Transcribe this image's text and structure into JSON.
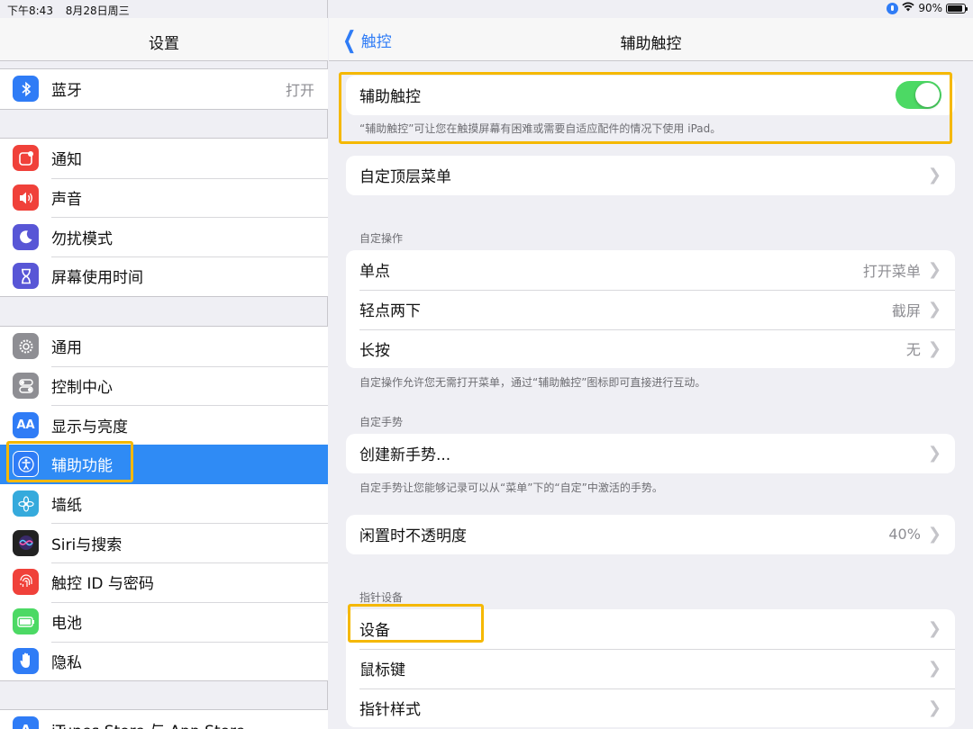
{
  "status_bar": {
    "time": "下午8:43",
    "date": "8月28日周三",
    "battery_pct": "90%",
    "battery_level": 0.9
  },
  "left": {
    "title": "设置",
    "group1": [
      {
        "icon": "bluetooth-icon",
        "label": "蓝牙",
        "value": "打开",
        "color": "#2f7cf6"
      }
    ],
    "group2": [
      {
        "icon": "notifications-icon",
        "label": "通知",
        "color": "#f0413a"
      },
      {
        "icon": "sound-icon",
        "label": "声音",
        "color": "#f0413a"
      },
      {
        "icon": "moon-icon",
        "label": "勿扰模式",
        "color": "#5856d6"
      },
      {
        "icon": "hourglass-icon",
        "label": "屏幕使用时间",
        "color": "#5856d6"
      }
    ],
    "group3": [
      {
        "icon": "gear-icon",
        "label": "通用",
        "color": "#8e8e93"
      },
      {
        "icon": "control-center-icon",
        "label": "控制中心",
        "color": "#8e8e93"
      },
      {
        "icon": "display-icon",
        "label": "显示与亮度",
        "color": "#2f7cf6"
      },
      {
        "icon": "accessibility-icon",
        "label": "辅助功能",
        "color": "#2f7cf6",
        "selected": true
      },
      {
        "icon": "wallpaper-icon",
        "label": "墙纸",
        "color": "#35aadc"
      },
      {
        "icon": "siri-icon",
        "label": "Siri与搜索",
        "color": "#222"
      },
      {
        "icon": "fingerprint-icon",
        "label": "触控 ID 与密码",
        "color": "#f0413a"
      },
      {
        "icon": "battery-icon",
        "label": "电池",
        "color": "#4cd964"
      },
      {
        "icon": "hand-icon",
        "label": "隐私",
        "color": "#2f7cf6"
      }
    ],
    "group4": [
      {
        "icon": "app-store-icon",
        "label": "iTunes Store 与 App Store",
        "color": "#2f7cf6"
      }
    ]
  },
  "right": {
    "back_label": "触控",
    "title": "辅助触控",
    "toggle": {
      "label": "辅助触控",
      "on": true,
      "note": "“辅助触控”可让您在触摸屏幕有困难或需要自适应配件的情况下使用 iPad。"
    },
    "top_menu": {
      "label": "自定顶层菜单"
    },
    "custom_actions": {
      "header": "自定操作",
      "items": [
        {
          "label": "单点",
          "value": "打开菜单"
        },
        {
          "label": "轻点两下",
          "value": "截屏"
        },
        {
          "label": "长按",
          "value": "无"
        }
      ],
      "note": "自定操作允许您无需打开菜单，通过“辅助触控”图标即可直接进行互动。"
    },
    "custom_gestures": {
      "header": "自定手势",
      "items": [
        {
          "label": "创建新手势..."
        }
      ],
      "note": "自定手势让您能够记录可以从“菜单”下的“自定”中激活的手势。"
    },
    "idle_opacity": {
      "label": "闲置时不透明度",
      "value": "40%"
    },
    "pointer_devices": {
      "header": "指针设备",
      "items": [
        {
          "label": "设备"
        },
        {
          "label": "鼠标键"
        },
        {
          "label": "指针样式"
        }
      ]
    }
  }
}
